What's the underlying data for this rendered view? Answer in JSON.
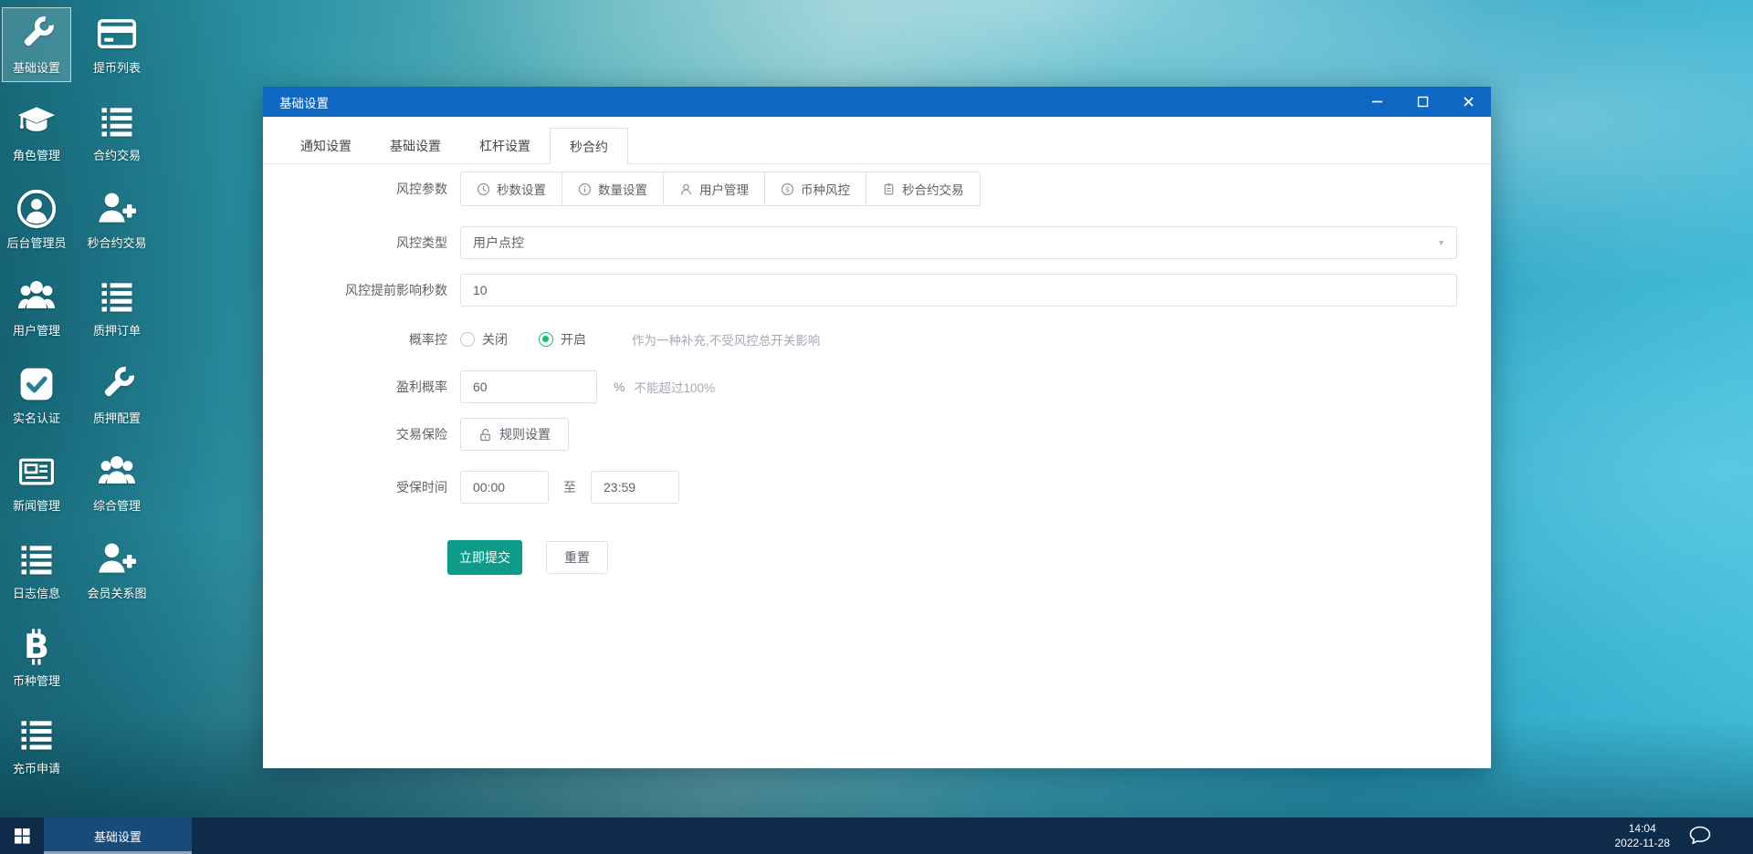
{
  "desktop": {
    "icons": [
      {
        "label": "基础设置",
        "icon": "wrench-icon",
        "selected": true
      },
      {
        "label": "提币列表",
        "icon": "card-icon"
      },
      {
        "label": "角色管理",
        "icon": "graduation-cap-icon"
      },
      {
        "label": "合约交易",
        "icon": "list-icon"
      },
      {
        "label": "后台管理员",
        "icon": "user-circle-icon"
      },
      {
        "label": "秒合约交易",
        "icon": "user-plus-icon"
      },
      {
        "label": "用户管理",
        "icon": "users-icon"
      },
      {
        "label": "质押订单",
        "icon": "list-icon"
      },
      {
        "label": "实名认证",
        "icon": "check-square-icon"
      },
      {
        "label": "质押配置",
        "icon": "wrench-icon"
      },
      {
        "label": "新闻管理",
        "icon": "newspaper-icon"
      },
      {
        "label": "综合管理",
        "icon": "users-icon"
      },
      {
        "label": "日志信息",
        "icon": "list-icon"
      },
      {
        "label": "会员关系图",
        "icon": "user-plus-icon"
      },
      {
        "label": "币种管理",
        "icon": "bitcoin-icon"
      },
      {
        "label": "充币申请",
        "icon": "list-icon"
      }
    ]
  },
  "window": {
    "title": "基础设置",
    "tabs": [
      {
        "label": "通知设置",
        "active": false
      },
      {
        "label": "基础设置",
        "active": false
      },
      {
        "label": "杠杆设置",
        "active": false
      },
      {
        "label": "秒合约",
        "active": true
      }
    ],
    "form": {
      "risk_params": {
        "label": "风控参数",
        "buttons": [
          {
            "icon": "clock-icon",
            "label": "秒数设置"
          },
          {
            "icon": "info-icon",
            "label": "数量设置"
          },
          {
            "icon": "user-icon",
            "label": "用户管理"
          },
          {
            "icon": "dollar-icon",
            "label": "币种风控"
          },
          {
            "icon": "document-icon",
            "label": "秒合约交易"
          }
        ]
      },
      "risk_type": {
        "label": "风控类型",
        "value": "用户点控"
      },
      "advance_seconds": {
        "label": "风控提前影响秒数",
        "value": "10"
      },
      "probability": {
        "label": "概率控",
        "off": "关闭",
        "on": "开启",
        "selected": "开启",
        "hint": "作为一种补充,不受风控总开关影响"
      },
      "profit": {
        "label": "盈利概率",
        "value": "60",
        "suffix": "%",
        "hint": "不能超过100%"
      },
      "insurance": {
        "label": "交易保险",
        "button": "规则设置"
      },
      "insured_time": {
        "label": "受保时间",
        "from": "00:00",
        "separator": "至",
        "to": "23:59"
      },
      "submit": "立即提交",
      "reset": "重置"
    }
  },
  "taskbar": {
    "active_item": "基础设置",
    "time": "14:04",
    "date": "2022-11-28"
  },
  "colors": {
    "titlebar_blue": "#0e67c2",
    "submit_teal": "#0d9b8a",
    "radio_green": "#19be6b",
    "taskbar_navy": "#0f2b4a",
    "active_task": "#1a4a78"
  }
}
